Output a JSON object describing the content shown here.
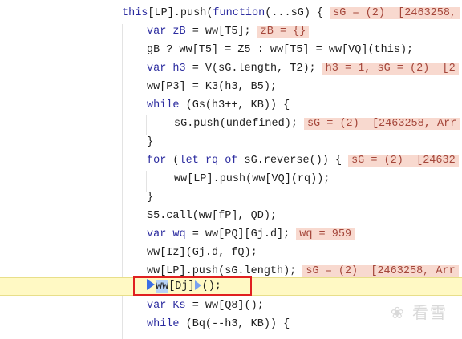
{
  "lines": [
    {
      "code": "this[LP].push(function(...sG) {",
      "hint": "sG = (2)  [2463258,"
    },
    {
      "code": "var zB = ww[T5];",
      "hint": "zB = {}"
    },
    {
      "code": "gB ? ww[T5] = Z5 : ww[T5] = ww[VQ](this);",
      "hint": ""
    },
    {
      "code": "var h3 = V(sG.length, T2);",
      "hint": "h3 = 1, sG = (2)  [2"
    },
    {
      "code": "ww[P3] = K3(h3, B5);",
      "hint": ""
    },
    {
      "code": "while (Gs(h3++, KB)) {",
      "hint": ""
    },
    {
      "code": "sG.push(undefined);",
      "hint": "sG = (2)  [2463258, Arr"
    },
    {
      "code": "}",
      "hint": ""
    },
    {
      "code": "for (let rq of sG.reverse()) {",
      "hint": "sG = (2)  [24632"
    },
    {
      "code": "ww[LP].push(ww[VQ](rq));",
      "hint": ""
    },
    {
      "code": "}",
      "hint": ""
    },
    {
      "code": "S5.call(ww[fP], QD);",
      "hint": ""
    },
    {
      "code": "var wq = ww[PQ][Gj.d];",
      "hint": "wq = 959"
    },
    {
      "code": "ww[Iz](Gj.d, fQ);",
      "hint": ""
    },
    {
      "code": "ww[LP].push(sG.length);",
      "hint": "sG = (2)  [2463258, Arr"
    },
    {
      "code": "ww[Dj]();",
      "hint": ""
    },
    {
      "code": "var Ks = ww[Q8]();",
      "hint": ""
    },
    {
      "code": "while (Bq(--h3, KB)) {",
      "hint": ""
    }
  ],
  "watermark": "看雪"
}
